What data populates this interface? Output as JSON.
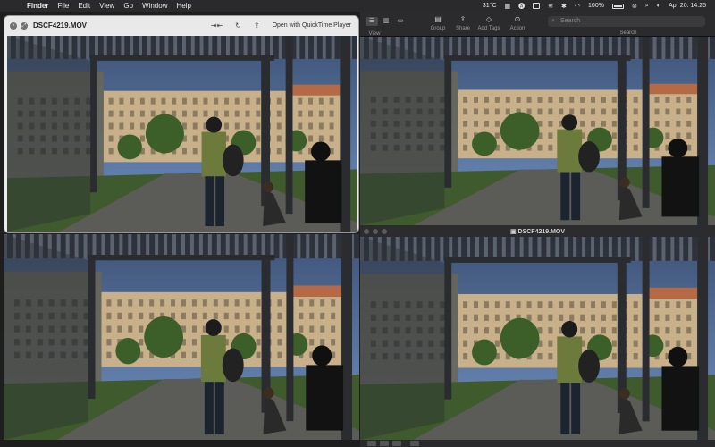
{
  "menubar": {
    "apple_icon": "apple-logo",
    "app_name": "Finder",
    "items": [
      "File",
      "Edit",
      "View",
      "Go",
      "Window",
      "Help"
    ],
    "temperature": "31°C",
    "battery": "100%",
    "date_time": "Apr 20.  14:25"
  },
  "finder_toolbar": {
    "view_label": "View",
    "group_label": "Group",
    "share_label": "Share",
    "add_tags_label": "Add Tags",
    "action_label": "Action",
    "search_placeholder": "Search",
    "search_label": "Search"
  },
  "quicklook": {
    "filename": "DSCF4219.MOV",
    "open_with": "Open with QuickTime Player"
  },
  "bottom_window": {
    "title": "DSCF4219.MOV"
  },
  "colors": {
    "sky_light": "#6f8fbf",
    "sky_dark": "#3e5377",
    "building": "#c7b08a",
    "roof": "#b56a45",
    "grass": "#3f5a2c",
    "pavement": "#5b5b58",
    "pergola": "#2a2c30"
  }
}
